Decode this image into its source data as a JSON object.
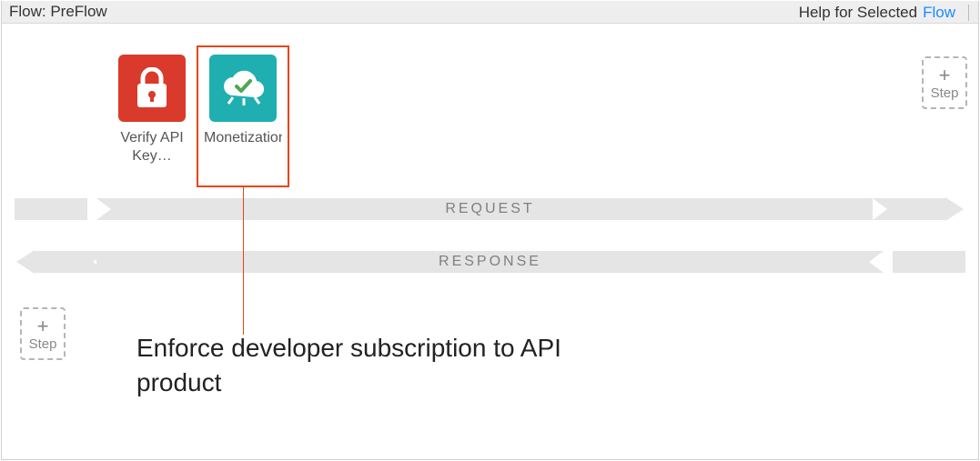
{
  "header": {
    "title": "Flow: PreFlow",
    "help_label": "Help for Selected",
    "flow_link": "Flow"
  },
  "policies": [
    {
      "label": "Verify API Key…",
      "icon": "lock-icon",
      "tile_color": "red"
    },
    {
      "label": "Monetization-…",
      "icon": "cloud-check-icon",
      "tile_color": "teal"
    }
  ],
  "flow": {
    "request_label": "REQUEST",
    "response_label": "RESPONSE"
  },
  "add_step": {
    "plus": "+",
    "label": "Step"
  },
  "annotation": "Enforce developer subscription to API product",
  "selected_policy_index": 1
}
